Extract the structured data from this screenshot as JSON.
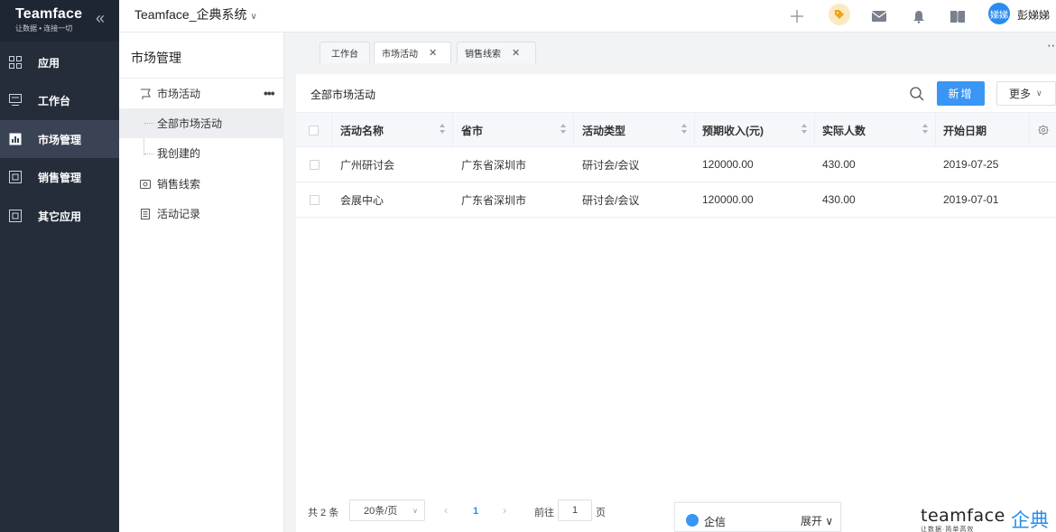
{
  "brand": {
    "name": "Teamface",
    "slogan": "让数据 • 连接一切"
  },
  "sidebar": {
    "items": [
      {
        "label": "应用",
        "icon": "grid-icon"
      },
      {
        "label": "工作台",
        "icon": "monitor-icon"
      },
      {
        "label": "市场管理",
        "icon": "chart-icon",
        "active": true
      },
      {
        "label": "销售管理",
        "icon": "box-icon"
      },
      {
        "label": "其它应用",
        "icon": "box-icon"
      }
    ]
  },
  "header": {
    "app_title": "Teamface_企典系统",
    "user_avatar": "娣娣",
    "user_name": "彭娣娣"
  },
  "subnav": {
    "title": "市场管理",
    "items": [
      {
        "label": "市场活动"
      },
      {
        "label": "全部市场活动"
      },
      {
        "label": "我创建的"
      },
      {
        "label": "销售线索"
      },
      {
        "label": "活动记录"
      }
    ]
  },
  "tabs": [
    {
      "label": "工作台"
    },
    {
      "label": "市场活动",
      "closable": true
    },
    {
      "label": "销售线索",
      "closable": true
    }
  ],
  "main": {
    "list_title": "全部市场活动",
    "new_label": "新增",
    "more_label": "更多"
  },
  "table": {
    "columns": [
      "活动名称",
      "省市",
      "活动类型",
      "预期收入(元)",
      "实际人数",
      "开始日期"
    ],
    "rows": [
      [
        "广州研讨会",
        "广东省深圳市",
        "研讨会/会议",
        "120000.00",
        "430.00",
        "2019-07-25"
      ],
      [
        "会展中心",
        "广东省深圳市",
        "研讨会/会议",
        "120000.00",
        "430.00",
        "2019-07-01"
      ]
    ]
  },
  "pager": {
    "total": "共 2 条",
    "page_size": "20条/页",
    "current": "1",
    "goto_label": "前往",
    "goto_value": "1",
    "goto_unit": "页"
  },
  "chat": {
    "label": "企信",
    "expand": "展开"
  },
  "watermark": {
    "en": "teamface",
    "cn": "企典",
    "slogan": "让数据·简单高效"
  },
  "colors": {
    "sidebar_bg": "#252d3b",
    "accent": "#3a96f4"
  }
}
